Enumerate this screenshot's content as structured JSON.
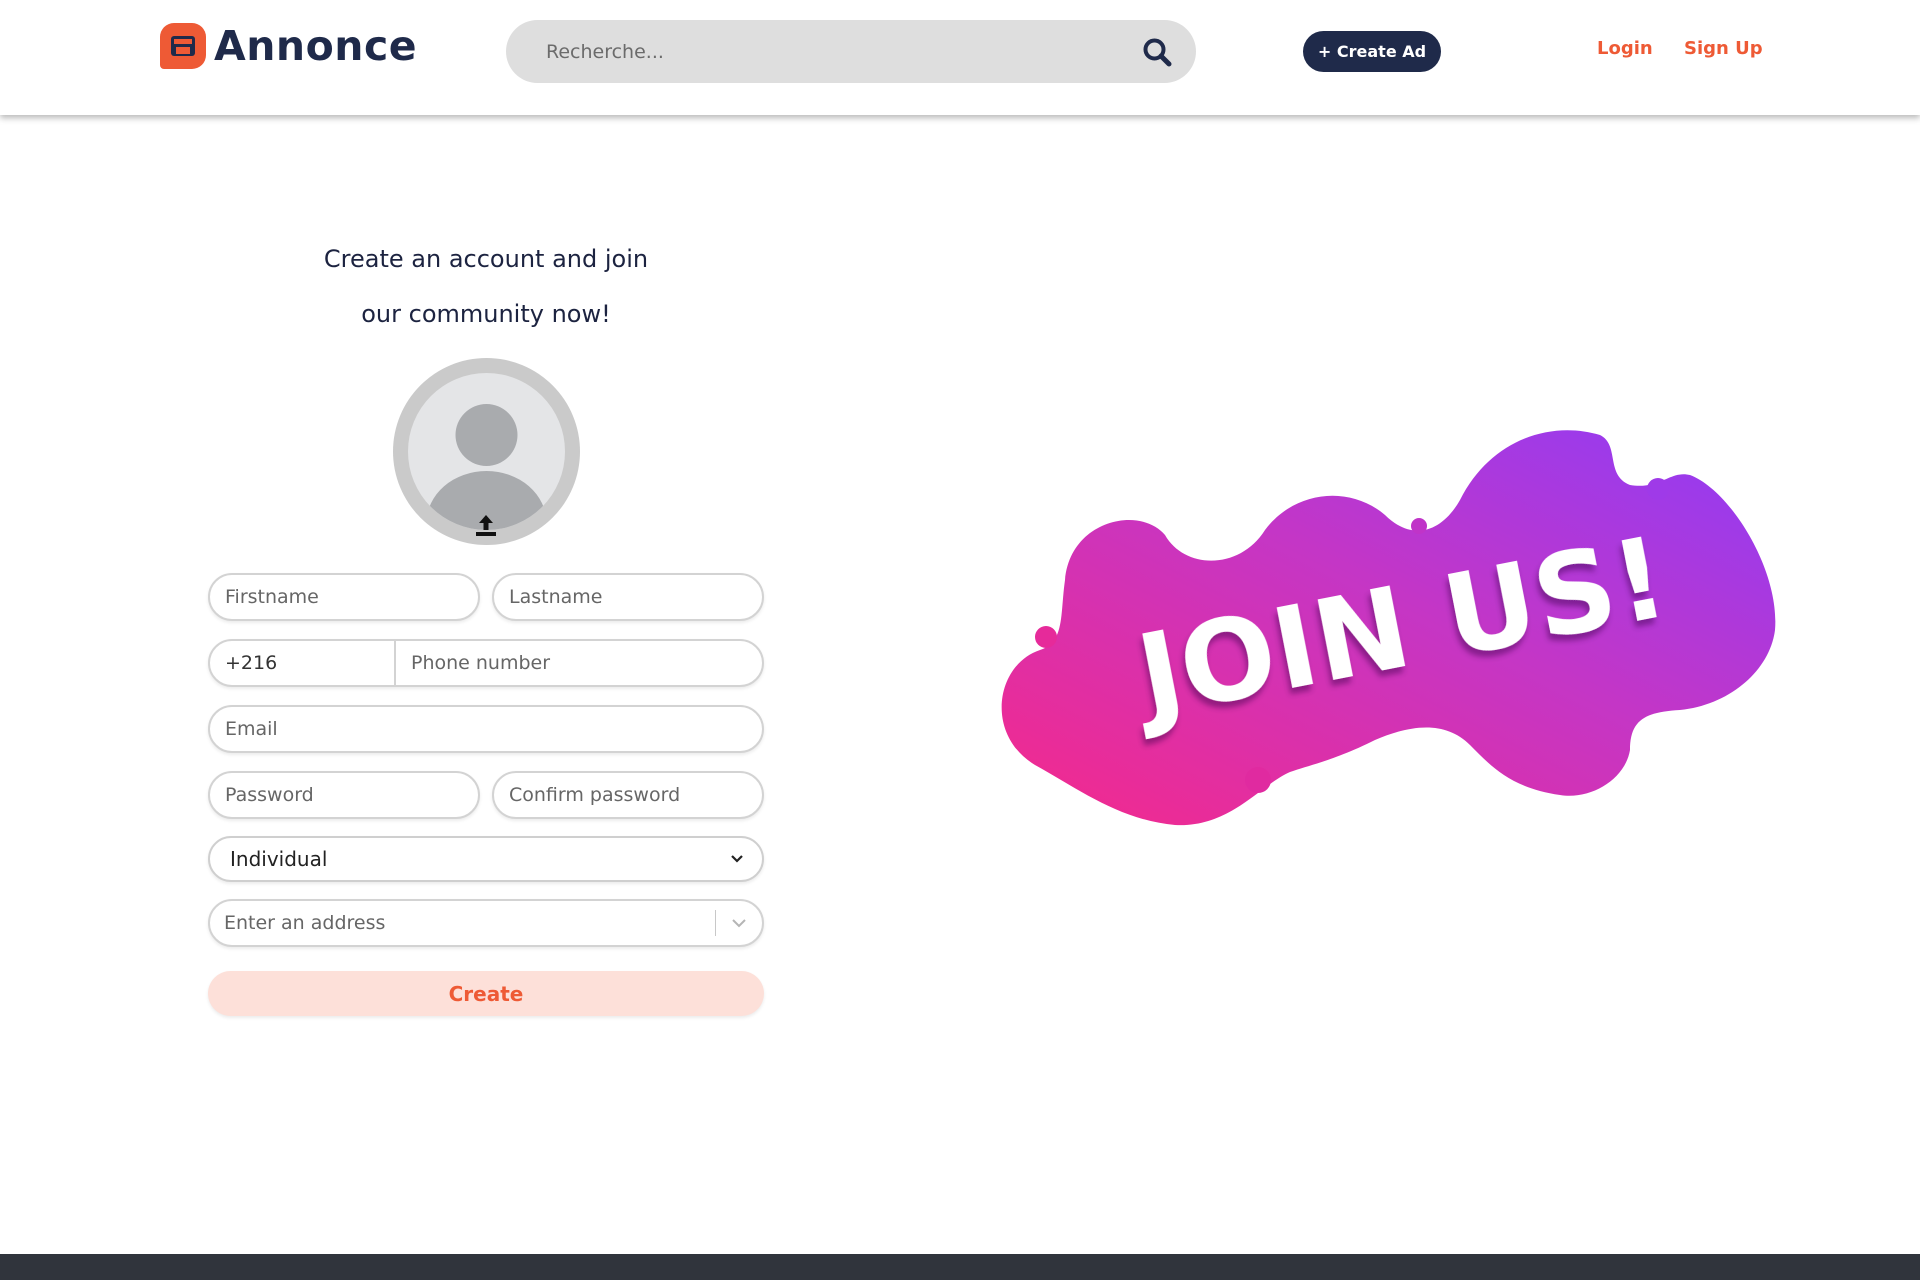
{
  "header": {
    "brand": "Annonce",
    "search_placeholder": "Recherche...",
    "create_ad_label": "+ Create Ad",
    "login_label": "Login",
    "signup_label": "Sign Up"
  },
  "form": {
    "title_line1": "Create an account and join",
    "title_line2": "our community now!",
    "firstname_placeholder": "Firstname",
    "lastname_placeholder": "Lastname",
    "phone_code": "+216",
    "phone_placeholder": "Phone number",
    "email_placeholder": "Email",
    "password_placeholder": "Password",
    "confirm_password_placeholder": "Confirm password",
    "account_type": "Individual",
    "address_placeholder": "Enter an address",
    "create_label": "Create"
  },
  "banner": {
    "text": "JOIN US!"
  },
  "colors": {
    "brand_orange": "#ee5a35",
    "navy": "#1f2a4a",
    "banner_pink": "#f0288c",
    "banner_purple": "#8f3cf5"
  },
  "icons": {
    "logo": "store-icon",
    "search": "search-icon",
    "avatar": "user-icon",
    "upload": "upload-icon",
    "select": "chevron-down-icon",
    "address": "chevron-down-icon"
  }
}
